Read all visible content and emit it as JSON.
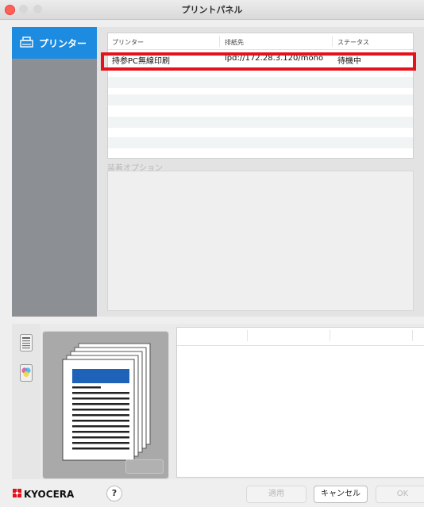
{
  "window": {
    "title": "プリントパネル"
  },
  "sidebar": {
    "items": [
      {
        "label": "プリンター",
        "icon": "printer-icon"
      }
    ]
  },
  "printers": {
    "headers": [
      "プリンター",
      "排紙先",
      "ステータス"
    ],
    "rows": [
      {
        "name": "持参PC無線印刷",
        "destination": "lpd://172.28.3.120/mono",
        "status": "待機中"
      }
    ]
  },
  "options": {
    "label": "装着オプション"
  },
  "footer": {
    "brand": "KYOCERA",
    "help": "?",
    "apply": "適用",
    "cancel": "キャンセル",
    "ok": "OK"
  },
  "colors": {
    "accent": "#1d8ce0",
    "highlight": "#e5121b",
    "brand_red": "#e5121b"
  }
}
